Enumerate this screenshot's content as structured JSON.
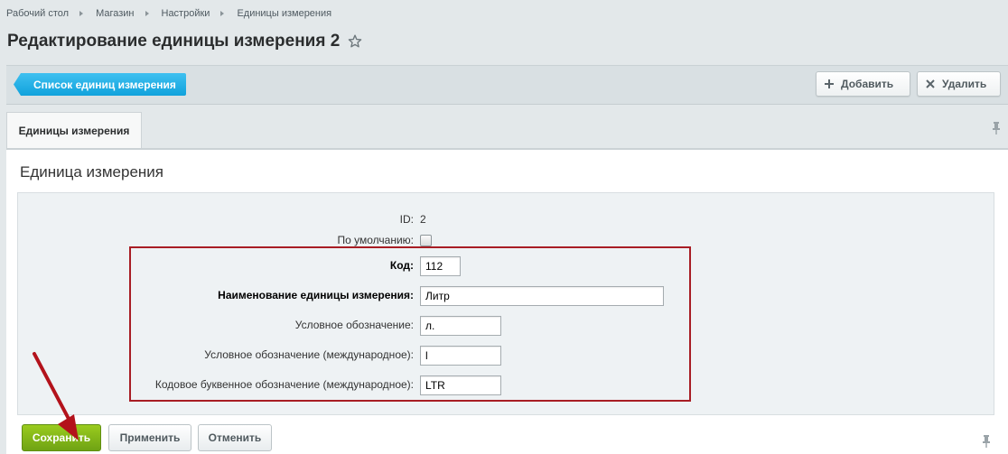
{
  "breadcrumb": [
    {
      "label": "Рабочий стол"
    },
    {
      "label": "Магазин"
    },
    {
      "label": "Настройки"
    },
    {
      "label": "Единицы измерения"
    }
  ],
  "page_title": "Редактирование единицы измерения 2",
  "toolbar": {
    "list_button": "Список единиц измерения",
    "add_button": "Добавить",
    "delete_button": "Удалить"
  },
  "tabs": {
    "active": "Единицы измерения"
  },
  "section_title": "Единица измерения",
  "form": {
    "id_label": "ID:",
    "id_value": "2",
    "default_label": "По умолчанию:",
    "default_checked": false,
    "code_label": "Код:",
    "code_value": "112",
    "name_label": "Наименование единицы измерения:",
    "name_value": "Литр",
    "symbol_label": "Условное обозначение:",
    "symbol_value": "л.",
    "symbol_intl_label": "Условное обозначение (международное):",
    "symbol_intl_value": "l",
    "letter_code_label": "Кодовое буквенное обозначение (международное):",
    "letter_code_value": "LTR"
  },
  "footer": {
    "save_button": "Сохранить",
    "apply_button": "Применить",
    "cancel_button": "Отменить"
  },
  "colors": {
    "accent_blue": "#1caee8",
    "save_green": "#7fb31a",
    "highlight_red": "#a81d24",
    "arrow_red": "#b3121b"
  },
  "icons": {
    "favorite": "star-icon",
    "add": "plus-icon",
    "delete": "close-icon",
    "pin": "pin-icon"
  }
}
